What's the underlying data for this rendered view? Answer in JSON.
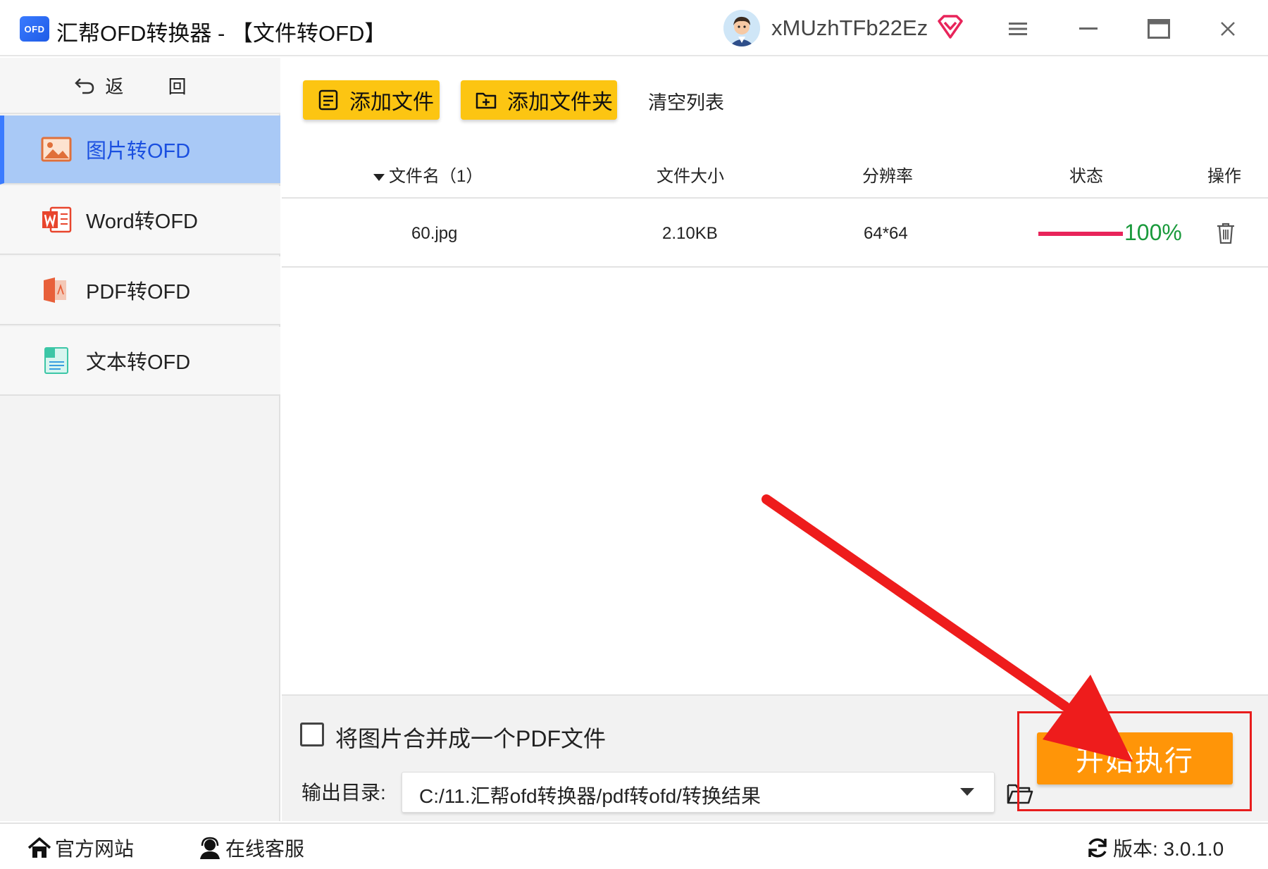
{
  "titlebar": {
    "logo_text": "OFD",
    "title": "汇帮OFD转换器 - 【文件转OFD】",
    "username": "xMUzhTFb22Ez",
    "icons": [
      "avatar",
      "vip-diamond-icon",
      "menu-icon",
      "minimize-icon",
      "maximize-icon",
      "close-icon"
    ]
  },
  "sidebar": {
    "back_label": "返 回",
    "items": [
      {
        "label": "图片转OFD",
        "icon": "image-icon",
        "active": true
      },
      {
        "label": "Word转OFD",
        "icon": "word-icon",
        "active": false
      },
      {
        "label": "PDF转OFD",
        "icon": "pdf-icon",
        "active": false
      },
      {
        "label": "文本转OFD",
        "icon": "text-file-icon",
        "active": false
      }
    ]
  },
  "toolbar": {
    "add_file_label": "添加文件",
    "add_folder_label": "添加文件夹",
    "clear_label": "清空列表"
  },
  "table": {
    "columns": [
      "文件名（1）",
      "文件大小",
      "分辨率",
      "状态",
      "操作"
    ],
    "rows": [
      {
        "name": "60.jpg",
        "size": "2.10KB",
        "resolution": "64*64",
        "progress": 1.0,
        "status": "100%"
      }
    ]
  },
  "bottom": {
    "merge_label": "将图片合并成一个PDF文件",
    "merge_checked": false,
    "output_label": "输出目录:",
    "output_path": "C:/11.汇帮ofd转换器/pdf转ofd/转换结果",
    "start_label": "开始执行"
  },
  "statusbar": {
    "site_label": "官方网站",
    "support_label": "在线客服",
    "version_label": "版本: 3.0.1.0"
  },
  "colors": {
    "accent_blue": "#3a7bff",
    "active_bg": "#a9c9f6",
    "button_yellow": "#fcc512",
    "start_orange": "#ff9508",
    "progress_red": "#e8245a",
    "success_green": "#1a9a3c",
    "annotation_red": "#e81d1d"
  }
}
